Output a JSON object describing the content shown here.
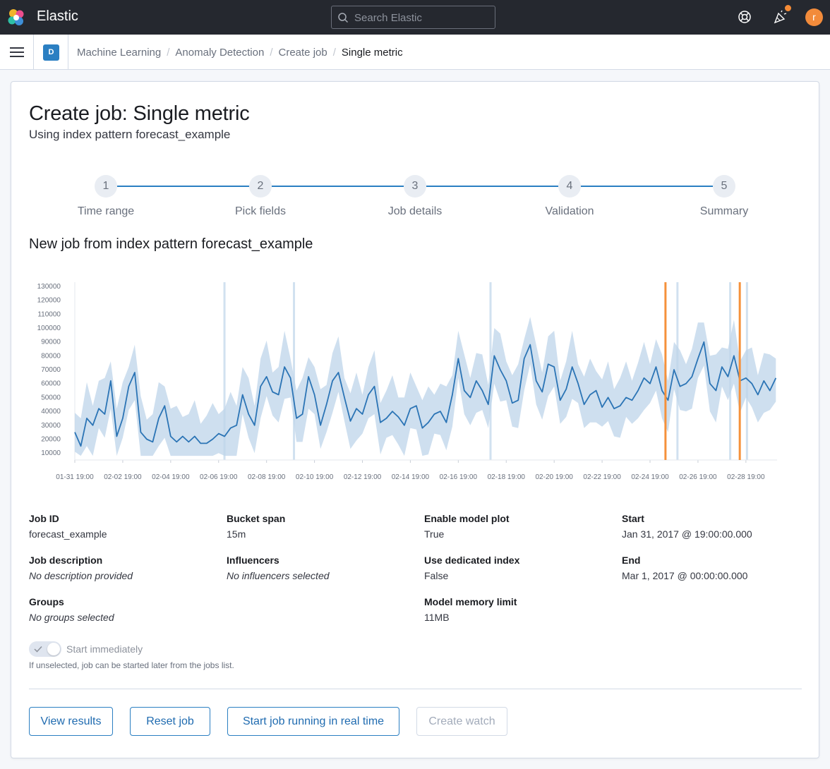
{
  "header": {
    "brand": "Elastic",
    "search_placeholder": "Search Elastic",
    "avatar_initial": "r",
    "logo": "elastic-logo",
    "icons": [
      "search-icon",
      "help-icon",
      "newsfeed-icon"
    ]
  },
  "subheader": {
    "space_initial": "D",
    "breadcrumbs": [
      "Machine Learning",
      "Anomaly Detection",
      "Create job",
      "Single metric"
    ]
  },
  "page": {
    "title": "Create job: Single metric",
    "subtitle": "Using index pattern forecast_example",
    "section_title": "New job from index pattern forecast_example"
  },
  "steps": [
    {
      "number": "1",
      "label": "Time range"
    },
    {
      "number": "2",
      "label": "Pick fields"
    },
    {
      "number": "3",
      "label": "Job details"
    },
    {
      "number": "4",
      "label": "Validation"
    },
    {
      "number": "5",
      "label": "Summary"
    }
  ],
  "chart_data": {
    "type": "line",
    "title": "",
    "xlabel": "",
    "ylabel": "",
    "y_ticks": [
      "10000",
      "20000",
      "30000",
      "40000",
      "50000",
      "60000",
      "70000",
      "80000",
      "90000",
      "100000",
      "110000",
      "120000",
      "130000"
    ],
    "x_ticks": [
      "01-31 19:00",
      "02-02 19:00",
      "02-04 19:00",
      "02-06 19:00",
      "02-08 19:00",
      "02-10 19:00",
      "02-12 19:00",
      "02-14 19:00",
      "02-16 19:00",
      "02-18 19:00",
      "02-20 19:00",
      "02-22 19:00",
      "02-24 19:00",
      "02-26 19:00",
      "02-28 19:00"
    ],
    "ylim": [
      5000,
      133000
    ],
    "xlim": [
      0,
      29.3
    ],
    "series": [
      {
        "values": [
          [
            0,
            25000
          ],
          [
            0.25,
            15000
          ],
          [
            0.5,
            35000
          ],
          [
            0.75,
            30000
          ],
          [
            1,
            42000
          ],
          [
            1.25,
            38000
          ],
          [
            1.5,
            62000
          ],
          [
            1.75,
            22000
          ],
          [
            2,
            35000
          ],
          [
            2.25,
            58000
          ],
          [
            2.5,
            68000
          ],
          [
            2.75,
            25000
          ],
          [
            3,
            20000
          ],
          [
            3.25,
            18000
          ],
          [
            3.5,
            35000
          ],
          [
            3.75,
            44000
          ],
          [
            4,
            22000
          ],
          [
            4.25,
            18000
          ],
          [
            4.5,
            22000
          ],
          [
            4.75,
            18000
          ],
          [
            5,
            22000
          ],
          [
            5.25,
            17000
          ],
          [
            5.5,
            17000
          ],
          [
            5.75,
            20000
          ],
          [
            6,
            24000
          ],
          [
            6.25,
            22000
          ],
          [
            6.5,
            28000
          ],
          [
            6.75,
            30000
          ],
          [
            7,
            52000
          ],
          [
            7.25,
            38000
          ],
          [
            7.5,
            30000
          ],
          [
            7.75,
            58000
          ],
          [
            8,
            65000
          ],
          [
            8.25,
            54000
          ],
          [
            8.5,
            52000
          ],
          [
            8.75,
            72000
          ],
          [
            9,
            64000
          ],
          [
            9.25,
            35000
          ],
          [
            9.5,
            38000
          ],
          [
            9.75,
            65000
          ],
          [
            10,
            52000
          ],
          [
            10.25,
            30000
          ],
          [
            10.5,
            45000
          ],
          [
            10.75,
            62000
          ],
          [
            11,
            68000
          ],
          [
            11.25,
            50000
          ],
          [
            11.5,
            33000
          ],
          [
            11.75,
            42000
          ],
          [
            12,
            38000
          ],
          [
            12.25,
            52000
          ],
          [
            12.5,
            58000
          ],
          [
            12.75,
            32000
          ],
          [
            13,
            35000
          ],
          [
            13.25,
            40000
          ],
          [
            13.5,
            36000
          ],
          [
            13.75,
            30000
          ],
          [
            14,
            42000
          ],
          [
            14.25,
            44000
          ],
          [
            14.5,
            28000
          ],
          [
            14.75,
            32000
          ],
          [
            15,
            38000
          ],
          [
            15.25,
            40000
          ],
          [
            15.5,
            32000
          ],
          [
            15.75,
            52000
          ],
          [
            16,
            78000
          ],
          [
            16.25,
            55000
          ],
          [
            16.5,
            50000
          ],
          [
            16.75,
            62000
          ],
          [
            17,
            55000
          ],
          [
            17.25,
            45000
          ],
          [
            17.5,
            80000
          ],
          [
            17.75,
            70000
          ],
          [
            18,
            62000
          ],
          [
            18.25,
            46000
          ],
          [
            18.5,
            48000
          ],
          [
            18.75,
            78000
          ],
          [
            19,
            88000
          ],
          [
            19.25,
            62000
          ],
          [
            19.5,
            54000
          ],
          [
            19.75,
            74000
          ],
          [
            20,
            72000
          ],
          [
            20.25,
            48000
          ],
          [
            20.5,
            56000
          ],
          [
            20.75,
            72000
          ],
          [
            21,
            60000
          ],
          [
            21.25,
            45000
          ],
          [
            21.5,
            52000
          ],
          [
            21.75,
            55000
          ],
          [
            22,
            43000
          ],
          [
            22.25,
            50000
          ],
          [
            22.5,
            42000
          ],
          [
            22.75,
            44000
          ],
          [
            23,
            50000
          ],
          [
            23.25,
            48000
          ],
          [
            23.5,
            55000
          ],
          [
            23.75,
            64000
          ],
          [
            24,
            60000
          ],
          [
            24.25,
            72000
          ],
          [
            24.5,
            55000
          ],
          [
            24.75,
            48000
          ],
          [
            25,
            70000
          ],
          [
            25.25,
            58000
          ],
          [
            25.5,
            60000
          ],
          [
            25.75,
            65000
          ],
          [
            26,
            78000
          ],
          [
            26.25,
            90000
          ],
          [
            26.5,
            60000
          ],
          [
            26.75,
            55000
          ],
          [
            27,
            72000
          ],
          [
            27.25,
            65000
          ],
          [
            27.5,
            80000
          ],
          [
            27.75,
            62000
          ],
          [
            28,
            64000
          ],
          [
            28.25,
            60000
          ],
          [
            28.5,
            52000
          ],
          [
            28.75,
            62000
          ],
          [
            29,
            55000
          ],
          [
            29.25,
            64000
          ]
        ]
      }
    ]
  },
  "details": {
    "job_id_label": "Job ID",
    "job_id": "forecast_example",
    "bucket_span_label": "Bucket span",
    "bucket_span": "15m",
    "model_plot_label": "Enable model plot",
    "model_plot": "True",
    "start_label": "Start",
    "start": "Jan 31, 2017 @ 19:00:00.000",
    "job_description_label": "Job description",
    "job_description": "No description provided",
    "influencers_label": "Influencers",
    "influencers": "No influencers selected",
    "dedicated_index_label": "Use dedicated index",
    "dedicated_index": "False",
    "end_label": "End",
    "end": "Mar 1, 2017 @ 00:00:00.000",
    "groups_label": "Groups",
    "groups": "No groups selected",
    "memory_limit_label": "Model memory limit",
    "memory_limit": "11MB"
  },
  "start_immediately": {
    "label": "Start immediately",
    "help": "If unselected, job can be started later from the jobs list.",
    "checked": true
  },
  "buttons": {
    "view_results": "View results",
    "reset_job": "Reset job",
    "start_realtime": "Start job running in real time",
    "create_watch": "Create watch"
  },
  "colors": {
    "accent": "#2b7fc2",
    "line": "#2b74b5",
    "band": "#bdd4ea",
    "anomaly": "#f5913b"
  }
}
